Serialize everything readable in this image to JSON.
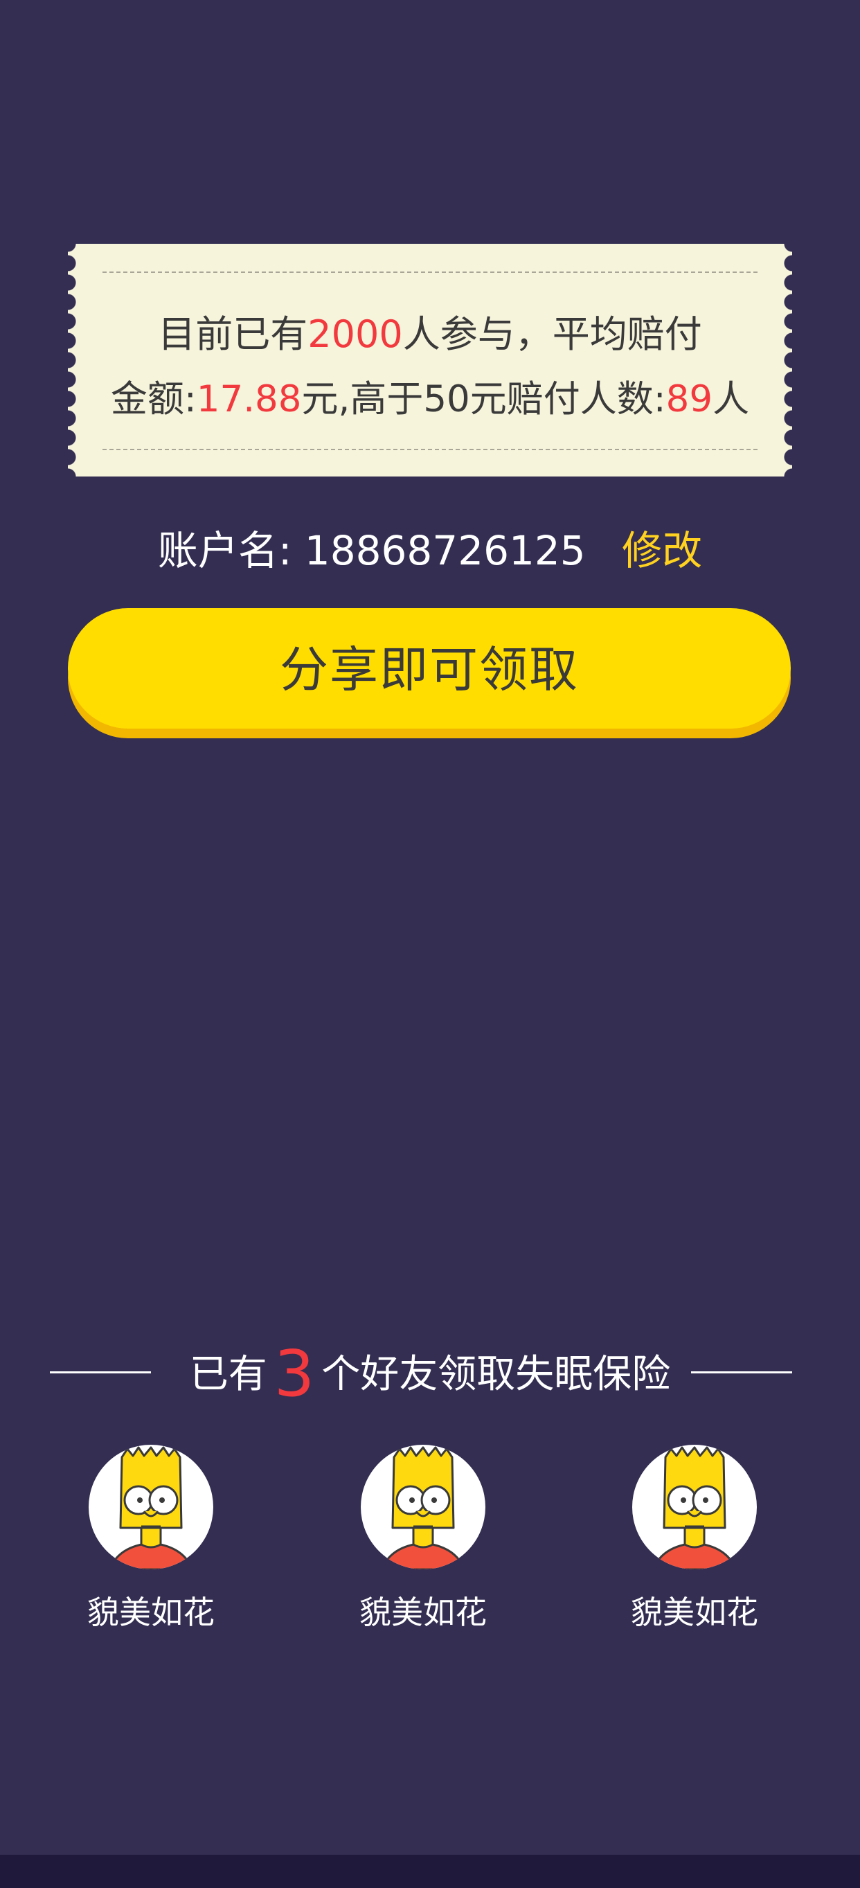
{
  "notice": {
    "line1_prefix": "目前已有",
    "participants": "2000",
    "line1_suffix": "人参与，平均赔付",
    "line2_prefix": "金额:",
    "avg_amount": "17.88",
    "line2_middle": "元,高于50元赔付人数:",
    "over50_count": "89",
    "line2_suffix": "人"
  },
  "account": {
    "label": "账户名:",
    "value": "18868726125",
    "edit_label": "修改"
  },
  "share_button": {
    "label": "分享即可领取"
  },
  "friends": {
    "title_prefix": "已有",
    "count": "3",
    "title_suffix": "个好友领取失眠保险",
    "items": [
      {
        "name": "貌美如花"
      },
      {
        "name": "貌美如花"
      },
      {
        "name": "貌美如花"
      }
    ]
  },
  "colors": {
    "background": "#332e52",
    "ticket": "#f7f4dc",
    "accent_red": "#f2393e",
    "button_yellow": "#ffdd00",
    "edit_yellow": "#ffd21f"
  }
}
